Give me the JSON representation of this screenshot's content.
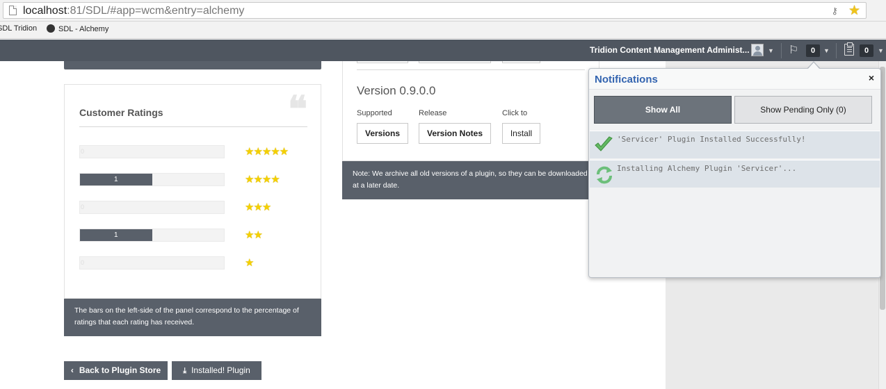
{
  "browser": {
    "url_host": "localhost",
    "url_rest": ":81/SDL/#app=wcm&entry=alchemy",
    "bookmarks": [
      "SDL Tridion",
      "SDL - Alchemy"
    ]
  },
  "header": {
    "user_name": "Tridion Content Management Administ...",
    "notifications_count": "0",
    "tasks_count": "0"
  },
  "ratings": {
    "title": "Customer Ratings",
    "rows": [
      {
        "stars": "★★★★★",
        "count": "0",
        "fill": 0
      },
      {
        "stars": "★★★★",
        "count": "1",
        "fill": 0.5
      },
      {
        "stars": "★★★",
        "count": "0",
        "fill": 0
      },
      {
        "stars": "★★",
        "count": "1",
        "fill": 0.5
      },
      {
        "stars": "★",
        "count": "0",
        "fill": 0
      }
    ],
    "note": "The bars on the left-side of the panel correspond to the percentage of ratings that each rating has received."
  },
  "version": {
    "title": "Version 0.9.0.0",
    "col_labels": [
      "Supported",
      "Release",
      "Click to"
    ],
    "buttons": [
      "Versions",
      "Version Notes",
      "Install"
    ],
    "note": "Note: We archive all old versions of a plugin, so they can be downloaded at a later date."
  },
  "actions": {
    "back_label": "Back to Plugin Store",
    "back_glyph": "‹",
    "installed_label": "Installed! Plugin",
    "installed_glyph": "⤓"
  },
  "notifications": {
    "title": "Notifications",
    "close": "×",
    "show_all": "Show All",
    "show_pending": "Show Pending Only (0)",
    "items": [
      {
        "text": "'Servicer' Plugin Installed Successfully!",
        "icon": "check-icon"
      },
      {
        "text": "Installing Alchemy Plugin 'Servicer'...",
        "icon": "refresh-icon"
      }
    ]
  },
  "colors": {
    "header_bg": "#4f5660",
    "panel_dark": "#59606a",
    "star": "#f5d000",
    "notif_title": "#3364b0",
    "success_green": "#5cb85c"
  }
}
